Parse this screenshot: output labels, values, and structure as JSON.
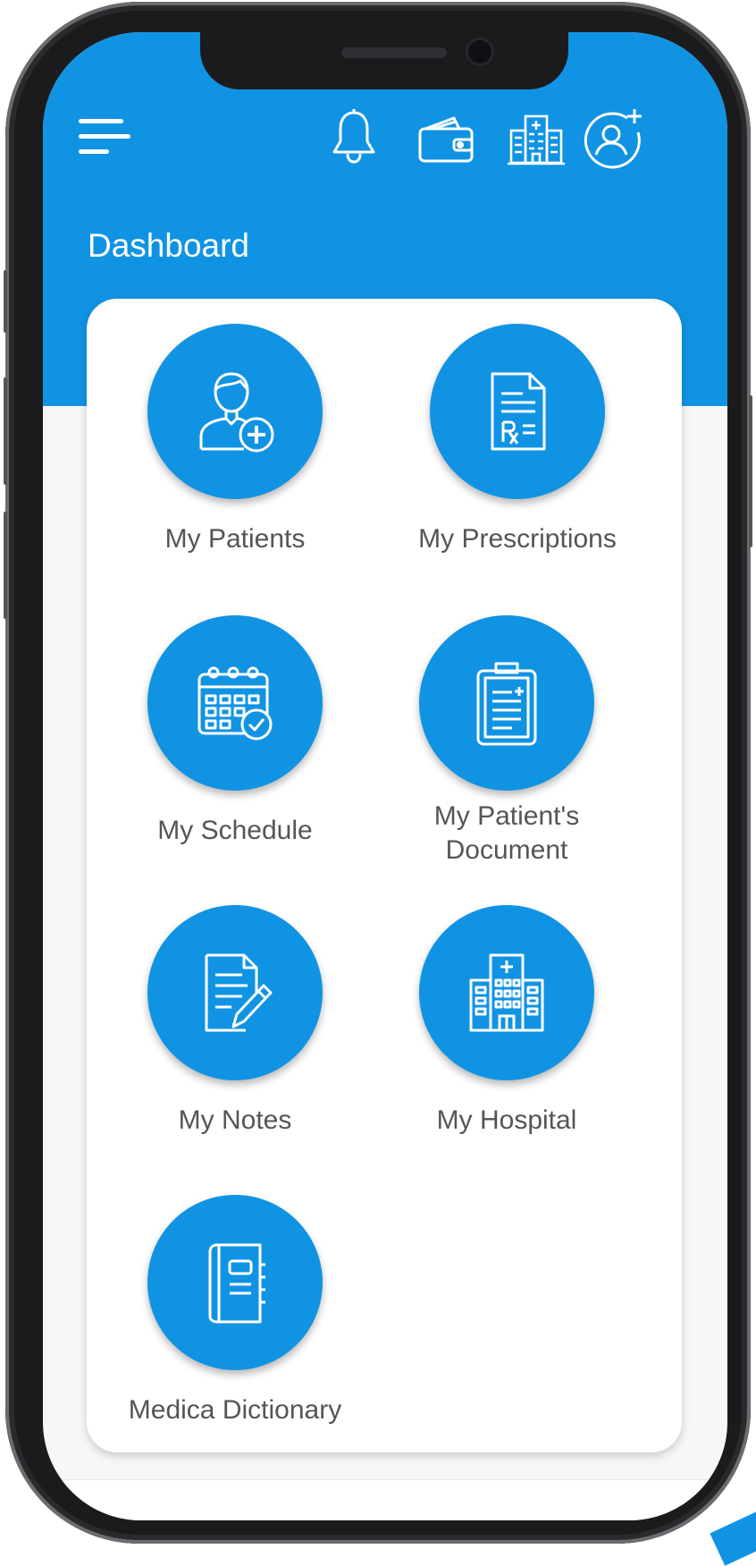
{
  "colors": {
    "primary": "#1193e3",
    "card": "#ffffff",
    "label": "#555555",
    "frame": "#1b1b1d"
  },
  "header": {
    "title": "Dashboard",
    "menu_icon": "hamburger-menu-icon",
    "actions": [
      {
        "icon": "bell-icon",
        "name": "notifications"
      },
      {
        "icon": "wallet-icon",
        "name": "wallet"
      },
      {
        "icon": "hospital-building-icon",
        "name": "hospital"
      },
      {
        "icon": "add-user-icon",
        "name": "add-profile"
      }
    ]
  },
  "dashboard": {
    "items": [
      {
        "label": "My Patients",
        "icon": "patient-add-icon"
      },
      {
        "label": "My Prescriptions",
        "icon": "prescription-rx-icon"
      },
      {
        "label": "My Schedule",
        "icon": "calendar-check-icon"
      },
      {
        "label": "My Patient's\nDocument",
        "icon": "clipboard-document-icon"
      },
      {
        "label": "My Notes",
        "icon": "note-pen-icon"
      },
      {
        "label": "My Hospital",
        "icon": "hospital-icon"
      },
      {
        "label": "Medica Dictionary",
        "icon": "book-icon"
      }
    ]
  }
}
